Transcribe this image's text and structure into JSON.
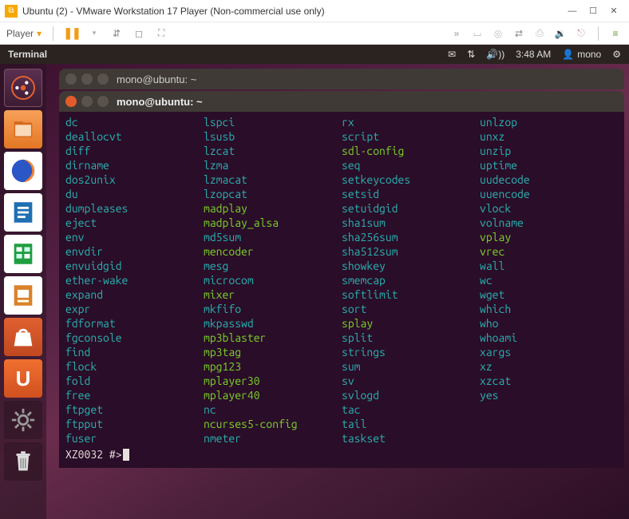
{
  "vmware": {
    "title": "Ubuntu (2) - VMware Workstation 17 Player (Non-commercial use only)",
    "playerMenu": "Player"
  },
  "ubuntu": {
    "appTitle": "Terminal",
    "clock": "3:48 AM",
    "user": "mono"
  },
  "terminal": {
    "bgTitle": "mono@ubuntu: ~",
    "fgTitle": "mono@ubuntu: ~",
    "prompt": "XZ0032 #>",
    "columns": [
      [
        {
          "t": "dc",
          "c": "teal"
        },
        {
          "t": "deallocvt",
          "c": "teal"
        },
        {
          "t": "diff",
          "c": "teal"
        },
        {
          "t": "dirname",
          "c": "teal"
        },
        {
          "t": "dos2unix",
          "c": "teal"
        },
        {
          "t": "du",
          "c": "teal"
        },
        {
          "t": "dumpleases",
          "c": "teal"
        },
        {
          "t": "eject",
          "c": "teal"
        },
        {
          "t": "env",
          "c": "teal"
        },
        {
          "t": "envdir",
          "c": "teal"
        },
        {
          "t": "envuidgid",
          "c": "teal"
        },
        {
          "t": "ether-wake",
          "c": "teal"
        },
        {
          "t": "expand",
          "c": "teal"
        },
        {
          "t": "expr",
          "c": "teal"
        },
        {
          "t": "fdformat",
          "c": "teal"
        },
        {
          "t": "fgconsole",
          "c": "teal"
        },
        {
          "t": "find",
          "c": "teal"
        },
        {
          "t": "flock",
          "c": "teal"
        },
        {
          "t": "fold",
          "c": "teal"
        },
        {
          "t": "free",
          "c": "teal"
        },
        {
          "t": "ftpget",
          "c": "teal"
        },
        {
          "t": "ftpput",
          "c": "teal"
        },
        {
          "t": "fuser",
          "c": "teal"
        }
      ],
      [
        {
          "t": "lspci",
          "c": "teal"
        },
        {
          "t": "lsusb",
          "c": "teal"
        },
        {
          "t": "lzcat",
          "c": "teal"
        },
        {
          "t": "lzma",
          "c": "teal"
        },
        {
          "t": "lzmacat",
          "c": "teal"
        },
        {
          "t": "lzopcat",
          "c": "teal"
        },
        {
          "t": "madplay",
          "c": "green"
        },
        {
          "t": "madplay_alsa",
          "c": "green"
        },
        {
          "t": "md5sum",
          "c": "teal"
        },
        {
          "t": "mencoder",
          "c": "green"
        },
        {
          "t": "mesg",
          "c": "teal"
        },
        {
          "t": "microcom",
          "c": "teal"
        },
        {
          "t": "mixer",
          "c": "green"
        },
        {
          "t": "mkfifo",
          "c": "teal"
        },
        {
          "t": "mkpasswd",
          "c": "teal"
        },
        {
          "t": "mp3blaster",
          "c": "green"
        },
        {
          "t": "mp3tag",
          "c": "green"
        },
        {
          "t": "mpg123",
          "c": "green"
        },
        {
          "t": "mplayer30",
          "c": "green"
        },
        {
          "t": "mplayer40",
          "c": "green"
        },
        {
          "t": "nc",
          "c": "teal"
        },
        {
          "t": "ncurses5-config",
          "c": "green"
        },
        {
          "t": "nmeter",
          "c": "teal"
        }
      ],
      [
        {
          "t": "rx",
          "c": "teal"
        },
        {
          "t": "script",
          "c": "teal"
        },
        {
          "t": "sdl-config",
          "c": "green"
        },
        {
          "t": "seq",
          "c": "teal"
        },
        {
          "t": "setkeycodes",
          "c": "teal"
        },
        {
          "t": "setsid",
          "c": "teal"
        },
        {
          "t": "setuidgid",
          "c": "teal"
        },
        {
          "t": "sha1sum",
          "c": "teal"
        },
        {
          "t": "sha256sum",
          "c": "teal"
        },
        {
          "t": "sha512sum",
          "c": "teal"
        },
        {
          "t": "showkey",
          "c": "teal"
        },
        {
          "t": "smemcap",
          "c": "teal"
        },
        {
          "t": "softlimit",
          "c": "teal"
        },
        {
          "t": "sort",
          "c": "teal"
        },
        {
          "t": "splay",
          "c": "green"
        },
        {
          "t": "split",
          "c": "teal"
        },
        {
          "t": "strings",
          "c": "teal"
        },
        {
          "t": "sum",
          "c": "teal"
        },
        {
          "t": "sv",
          "c": "teal"
        },
        {
          "t": "svlogd",
          "c": "teal"
        },
        {
          "t": "tac",
          "c": "teal"
        },
        {
          "t": "tail",
          "c": "teal"
        },
        {
          "t": "taskset",
          "c": "teal"
        }
      ],
      [
        {
          "t": "unlzop",
          "c": "teal"
        },
        {
          "t": "unxz",
          "c": "teal"
        },
        {
          "t": "unzip",
          "c": "teal"
        },
        {
          "t": "uptime",
          "c": "teal"
        },
        {
          "t": "uudecode",
          "c": "teal"
        },
        {
          "t": "uuencode",
          "c": "teal"
        },
        {
          "t": "vlock",
          "c": "teal"
        },
        {
          "t": "volname",
          "c": "teal"
        },
        {
          "t": "vplay",
          "c": "green"
        },
        {
          "t": "vrec",
          "c": "green"
        },
        {
          "t": "wall",
          "c": "teal"
        },
        {
          "t": "wc",
          "c": "teal"
        },
        {
          "t": "wget",
          "c": "teal"
        },
        {
          "t": "which",
          "c": "teal"
        },
        {
          "t": "who",
          "c": "teal"
        },
        {
          "t": "whoami",
          "c": "teal"
        },
        {
          "t": "xargs",
          "c": "teal"
        },
        {
          "t": "xz",
          "c": "teal"
        },
        {
          "t": "xzcat",
          "c": "teal"
        },
        {
          "t": "yes",
          "c": "teal"
        }
      ]
    ]
  }
}
